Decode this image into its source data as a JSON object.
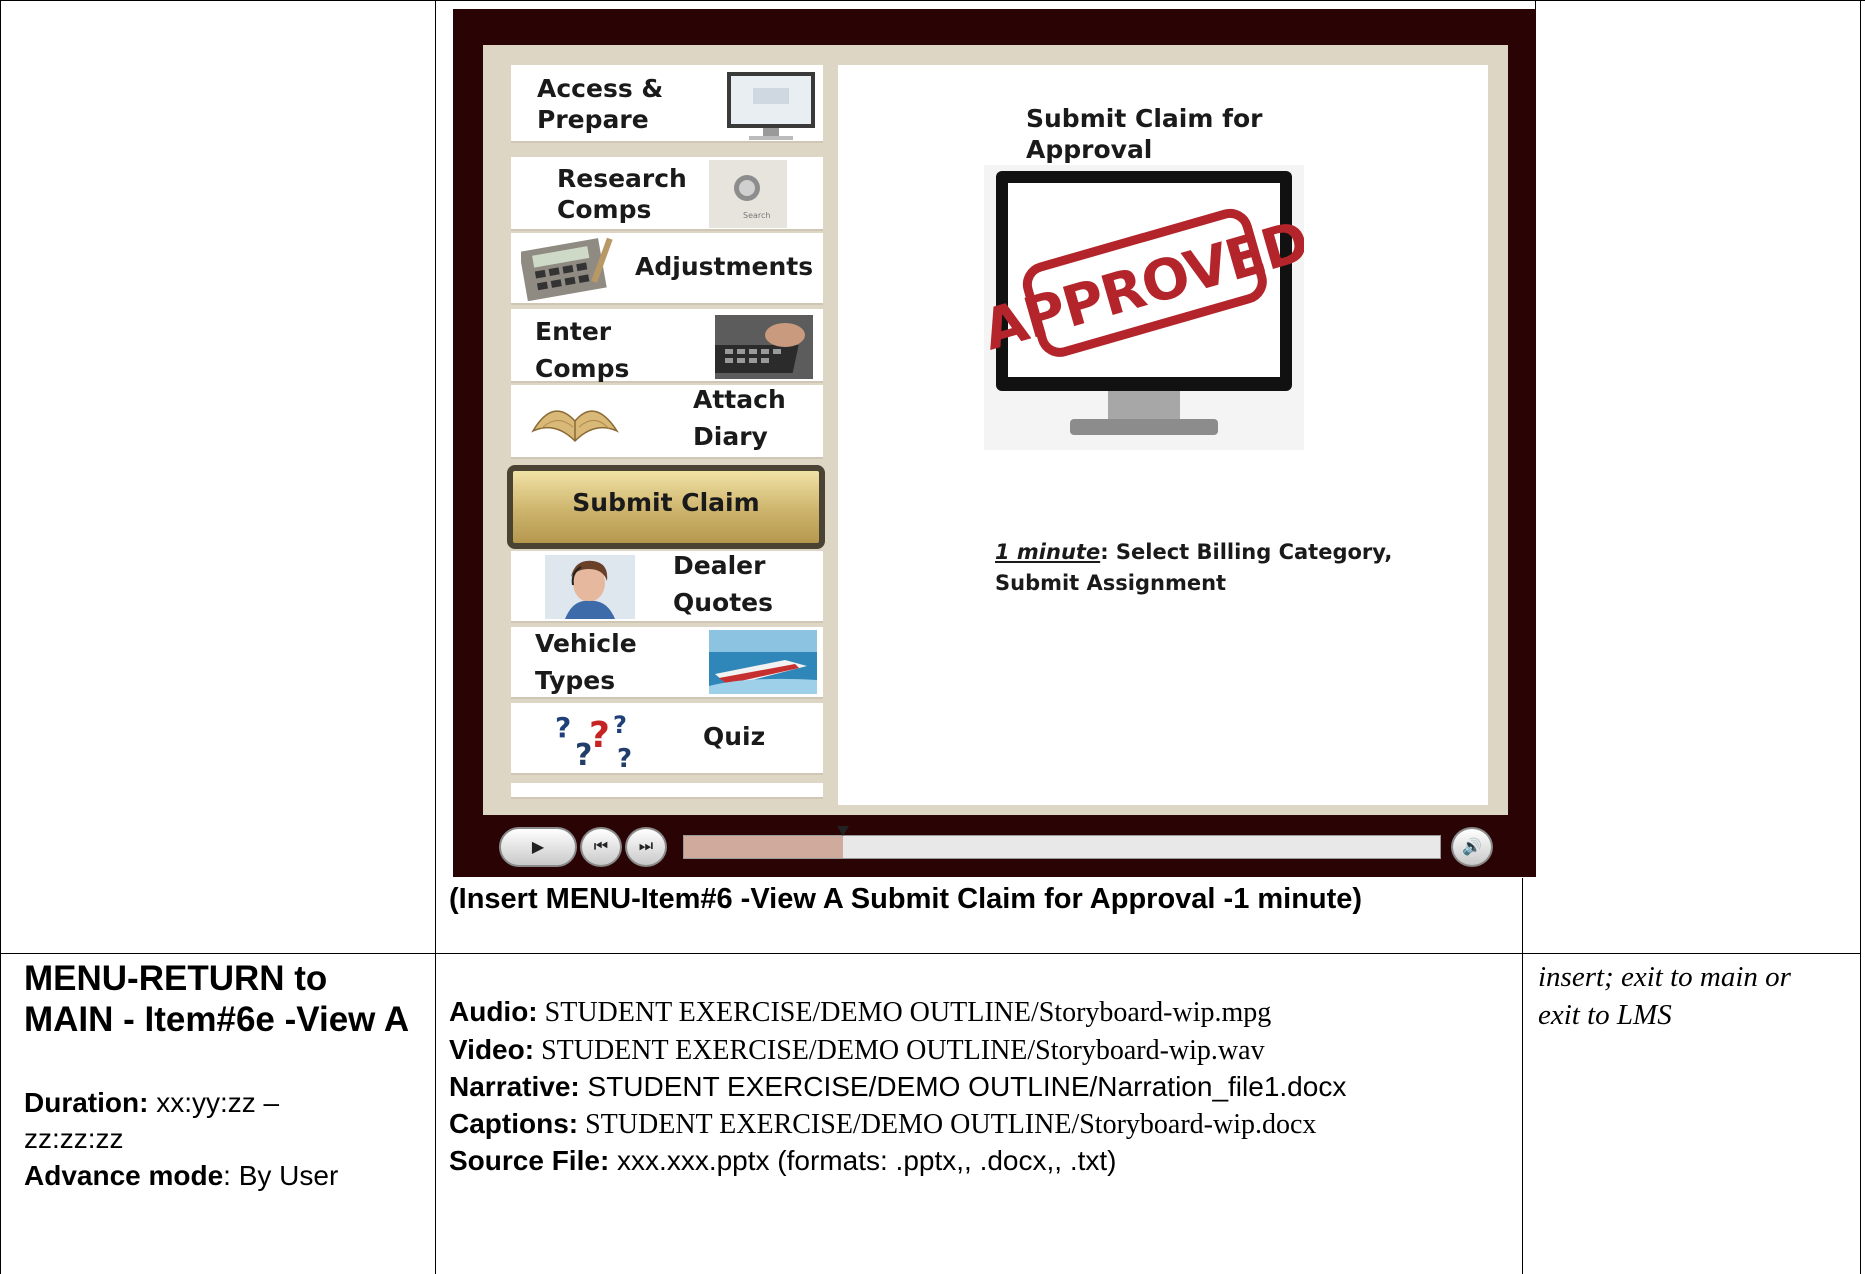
{
  "slide": {
    "menu": [
      {
        "label": "Access &\nPrepare",
        "icon": "monitor-login-icon"
      },
      {
        "label": "Research\nComps",
        "icon": "search-button-icon"
      },
      {
        "label": "Adjustments",
        "icon": "calculator-icon"
      },
      {
        "label": "Enter\nComps",
        "icon": "keyboard-icon"
      },
      {
        "label": "Attach\nDiary",
        "icon": "open-book-icon"
      },
      {
        "label": "Submit Claim",
        "icon": "",
        "active": true
      },
      {
        "label": "Dealer\nQuotes",
        "icon": "headset-agent-icon"
      },
      {
        "label": "Vehicle\nTypes",
        "icon": "speedboat-icon"
      },
      {
        "label": "Quiz",
        "icon": "question-marks-icon"
      }
    ],
    "content": {
      "title": "Submit Claim for\nApproval",
      "stamp_text": "APPROVED",
      "duration": "1 minute",
      "duration_rest": ": Select Billing Category,",
      "duration_line2": "Submit Assignment"
    },
    "player": {
      "progress": 0.21,
      "play_icon": "▶",
      "prev_icon": "⏮",
      "next_icon": "⏭",
      "volume_icon": "🔊"
    },
    "colors": {
      "frame": "#2a0404",
      "active_item": "#c9ae62",
      "stamp_red": "#b3252b"
    }
  },
  "caption": "(Insert MENU-Item#6 -View A Submit Claim for Approval -1 minute)",
  "screen": {
    "name": "MENU-RETURN to MAIN - Item#6e -View A",
    "duration_label": "Duration:",
    "duration_value": " xx:yy:zz –",
    "duration_value2": "zz:zz:zz",
    "advance_label": "Advance mode",
    "advance_value": ": By User"
  },
  "files": {
    "audio_label": "Audio:",
    "audio_value": " STUDENT EXERCISE/DEMO OUTLINE/Storyboard-wip.mpg",
    "video_label": "Video:",
    "video_value": " STUDENT EXERCISE/DEMO OUTLINE/Storyboard-wip.wav",
    "narrative_label": "Narrative:",
    "narrative_value": " STUDENT EXERCISE/DEMO OUTLINE/Narration_file1.docx",
    "captions_label": "Captions:",
    "captions_value": " STUDENT EXERCISE/DEMO OUTLINE/Storyboard-wip.docx",
    "source_label": "Source File:",
    "source_value": " xxx.xxx.pptx  (formats: .pptx,, .docx,, .txt)"
  },
  "notes": "insert; exit to main or exit to LMS"
}
